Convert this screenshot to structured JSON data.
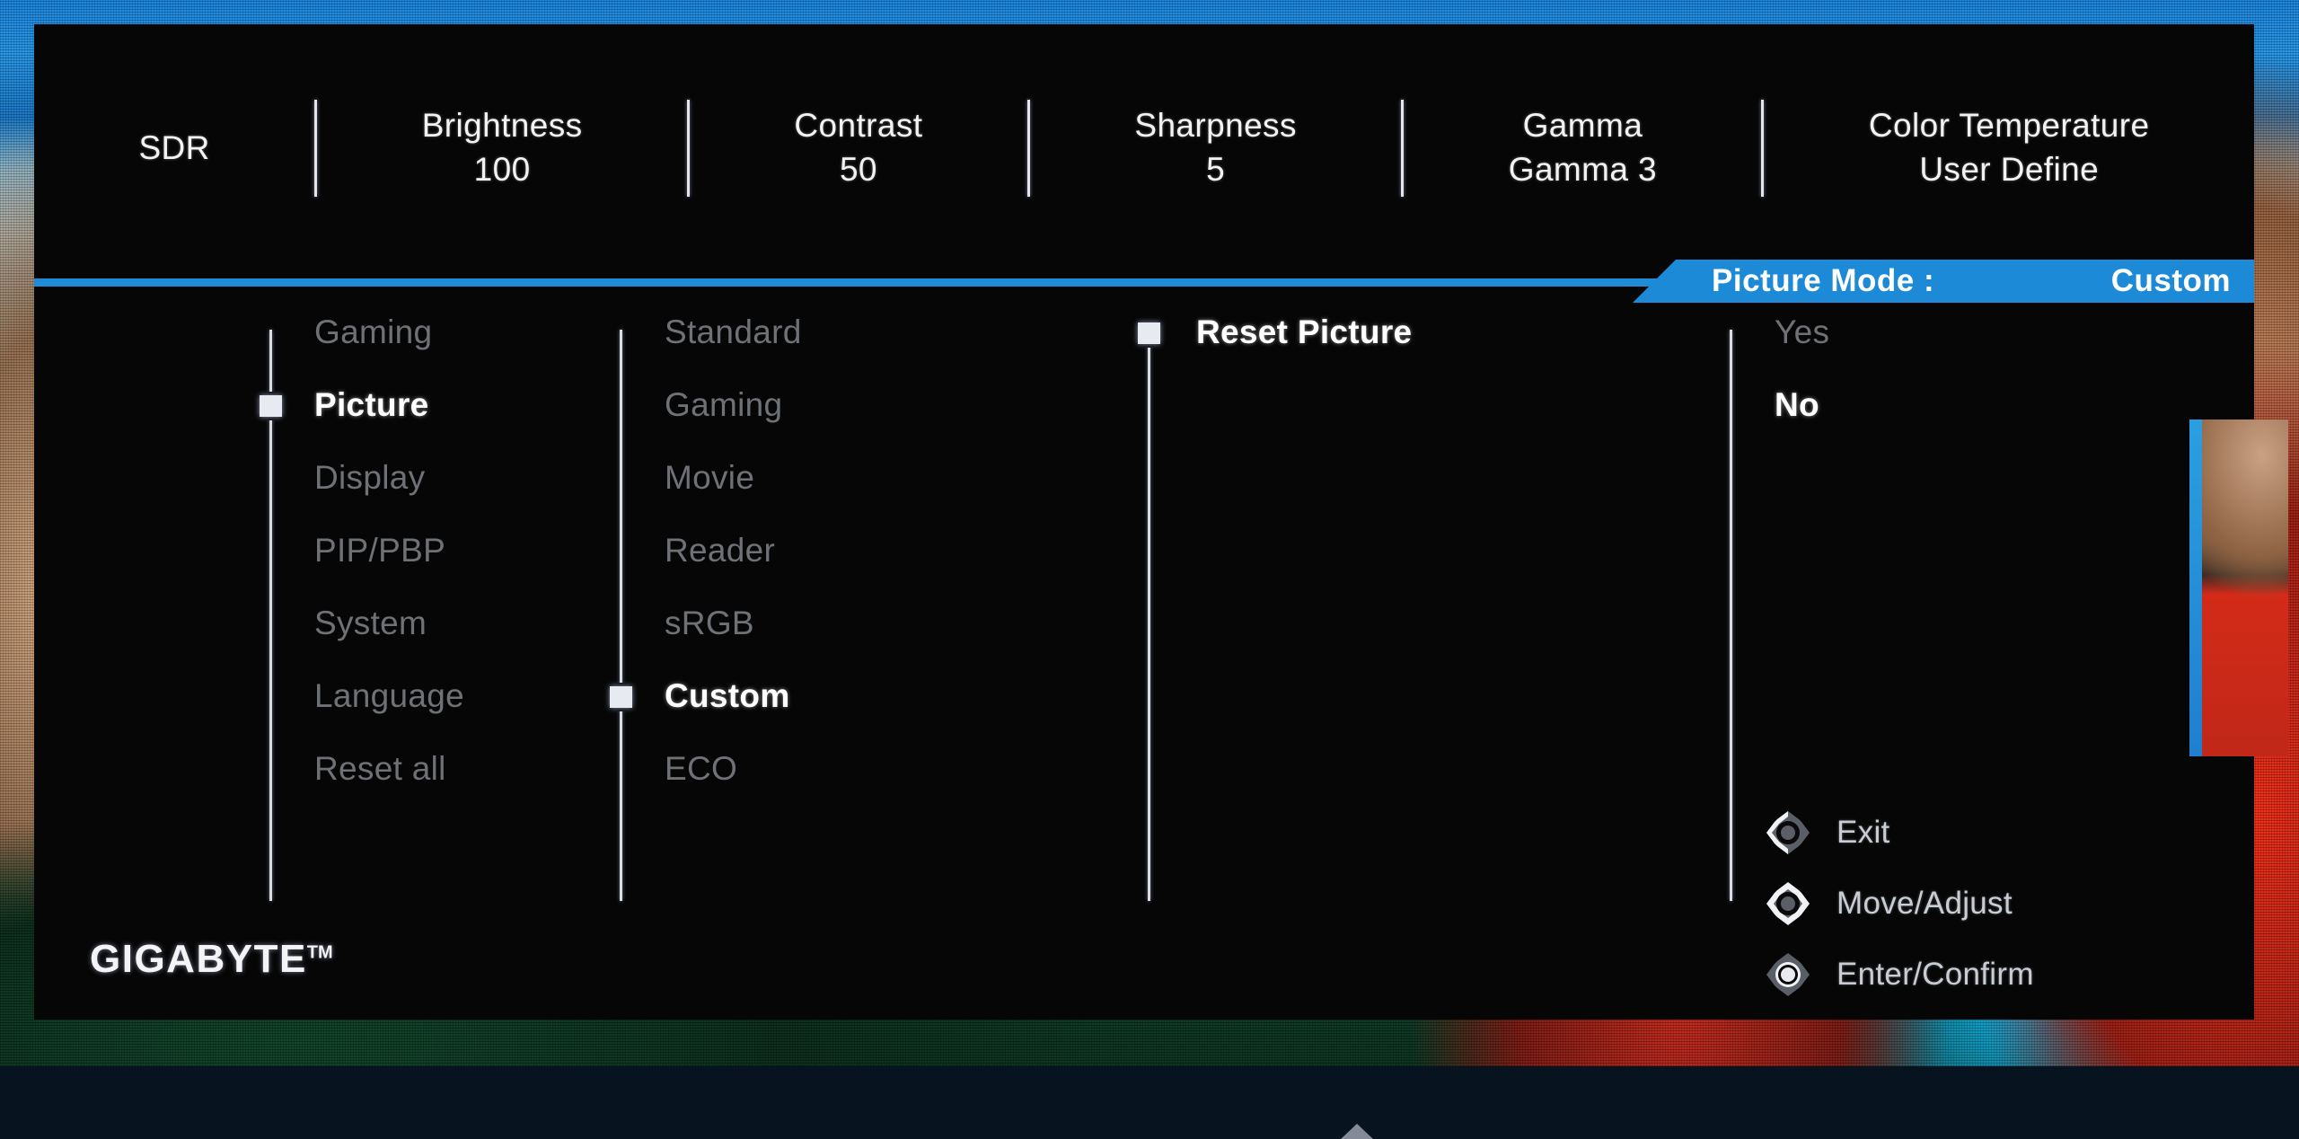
{
  "header": {
    "items": [
      {
        "label": "SDR",
        "value": ""
      },
      {
        "label": "Brightness",
        "value": "100"
      },
      {
        "label": "Contrast",
        "value": "50"
      },
      {
        "label": "Sharpness",
        "value": "5"
      },
      {
        "label": "Gamma",
        "value": "Gamma 3"
      },
      {
        "label": "Color Temperature",
        "value": "User Define"
      }
    ]
  },
  "picture_mode_banner": {
    "label": "Picture Mode  :",
    "value": "Custom"
  },
  "menu": {
    "column1": {
      "name": "main-menu",
      "items": [
        {
          "label": "Gaming",
          "selected": false
        },
        {
          "label": "Picture",
          "selected": true
        },
        {
          "label": "Display",
          "selected": false
        },
        {
          "label": "PIP/PBP",
          "selected": false
        },
        {
          "label": "System",
          "selected": false
        },
        {
          "label": "Language",
          "selected": false
        },
        {
          "label": "Reset all",
          "selected": false
        }
      ]
    },
    "column2": {
      "name": "picture-mode-list",
      "items": [
        {
          "label": "Standard",
          "selected": false
        },
        {
          "label": "Gaming",
          "selected": false
        },
        {
          "label": "Movie",
          "selected": false
        },
        {
          "label": "Reader",
          "selected": false
        },
        {
          "label": "sRGB",
          "selected": false
        },
        {
          "label": "Custom",
          "selected": true
        },
        {
          "label": "ECO",
          "selected": false
        }
      ]
    },
    "column3": {
      "name": "picture-submenu",
      "items": [
        {
          "label": "Reset Picture",
          "selected": true
        }
      ]
    },
    "column4": {
      "name": "confirm-list",
      "items": [
        {
          "label": "Yes",
          "selected": false
        },
        {
          "label": "No",
          "selected": true
        }
      ]
    }
  },
  "legend": [
    {
      "icon": "joystick-left-icon",
      "label": "Exit"
    },
    {
      "icon": "joystick-ring-icon",
      "label": "Move/Adjust"
    },
    {
      "icon": "joystick-center-icon",
      "label": "Enter/Confirm"
    }
  ],
  "brand": {
    "name": "GIGABYTE",
    "trademark": "TM"
  },
  "colors": {
    "accent_blue": "#1d8ad8",
    "panel_black": "#060606",
    "active_text": "#ffffff",
    "inactive_text": "#6e7176",
    "rail": "#dcdcdc"
  }
}
